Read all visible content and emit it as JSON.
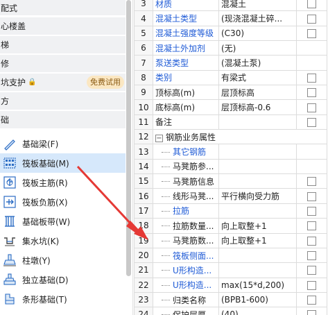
{
  "left": {
    "categories": [
      {
        "label": "配式"
      },
      {
        "label": "心楼盖"
      },
      {
        "label": "梯"
      },
      {
        "label": "修"
      },
      {
        "label": "坑支护",
        "badge": "免费试用",
        "locked": true
      },
      {
        "label": "方"
      },
      {
        "label": "础"
      }
    ],
    "items": [
      {
        "label": "基础梁(F)",
        "icon": "beam-icon"
      },
      {
        "label": "筏板基础(M)",
        "icon": "raft-grid-icon",
        "selected": true
      },
      {
        "label": "筏板主筋(R)",
        "icon": "main-rebar-icon"
      },
      {
        "label": "筏板负筋(X)",
        "icon": "negative-rebar-icon"
      },
      {
        "label": "基础板带(W)",
        "icon": "slab-strip-icon"
      },
      {
        "label": "集水坑(K)",
        "icon": "sump-pit-icon"
      },
      {
        "label": "柱墩(Y)",
        "icon": "column-pier-icon"
      },
      {
        "label": "独立基础(D)",
        "icon": "isolated-footing-icon"
      },
      {
        "label": "条形基础(T)",
        "icon": "strip-footing-icon"
      }
    ]
  },
  "table": {
    "rows": [
      {
        "num": "3",
        "name": "材质",
        "value": "混凝土",
        "blue": true,
        "check": true
      },
      {
        "num": "4",
        "name": "混凝土类型",
        "value": "(现浇混凝土碎...",
        "blue": true,
        "check": true
      },
      {
        "num": "5",
        "name": "混凝土强度等级",
        "value": "(C30)",
        "blue": true,
        "check": true
      },
      {
        "num": "6",
        "name": "混凝土外加剂",
        "value": "(无)",
        "blue": true,
        "check": false
      },
      {
        "num": "7",
        "name": "泵送类型",
        "value": "(混凝土泵)",
        "blue": true,
        "check": false
      },
      {
        "num": "8",
        "name": "类别",
        "value": "有梁式",
        "blue": true,
        "check": true
      },
      {
        "num": "9",
        "name": "顶标高(m)",
        "value": "层顶标高",
        "blue": false,
        "check": true
      },
      {
        "num": "10",
        "name": "底标高(m)",
        "value": "层顶标高-0.6",
        "blue": false,
        "check": true
      },
      {
        "num": "11",
        "name": "备注",
        "value": "",
        "blue": false,
        "check": true
      },
      {
        "num": "12",
        "name": "钢筋业务属性",
        "value": "",
        "blue": false,
        "check": false,
        "group": true
      },
      {
        "num": "13",
        "name": "其它钢筋",
        "value": "",
        "blue": true,
        "check": false,
        "child": true
      },
      {
        "num": "14",
        "name": "马凳筋参...",
        "value": "",
        "blue": false,
        "check": false,
        "child": true
      },
      {
        "num": "15",
        "name": "马凳筋信息",
        "value": "",
        "blue": false,
        "check": true,
        "child": true
      },
      {
        "num": "16",
        "name": "线形马凳...",
        "value": "平行横向受力筋",
        "blue": false,
        "check": true,
        "child": true
      },
      {
        "num": "17",
        "name": "拉筋",
        "value": "",
        "blue": true,
        "check": true,
        "child": true
      },
      {
        "num": "18",
        "name": "拉筋数量...",
        "value": "向上取整+1",
        "blue": false,
        "check": true,
        "child": true
      },
      {
        "num": "19",
        "name": "马凳筋数...",
        "value": "向上取整+1",
        "blue": false,
        "check": true,
        "child": true
      },
      {
        "num": "20",
        "name": "筏板侧面...",
        "value": "",
        "blue": true,
        "check": true,
        "child": true
      },
      {
        "num": "21",
        "name": "U形构造...",
        "value": "",
        "blue": true,
        "check": true,
        "child": true
      },
      {
        "num": "22",
        "name": "U形构造...",
        "value": "max(15*d,200)",
        "blue": true,
        "check": true,
        "child": true
      },
      {
        "num": "23",
        "name": "归类名称",
        "value": "(BPB1-600)",
        "blue": false,
        "check": true,
        "child": true
      },
      {
        "num": "24",
        "name": "保护层厚...",
        "value": "(40)",
        "blue": false,
        "check": true,
        "child": true
      }
    ]
  },
  "colors": {
    "selected_bg": "#d6e8fb",
    "link_blue": "#1f5bd6",
    "arrow_red": "#e53935",
    "badge_bg": "#fbe7c2"
  }
}
